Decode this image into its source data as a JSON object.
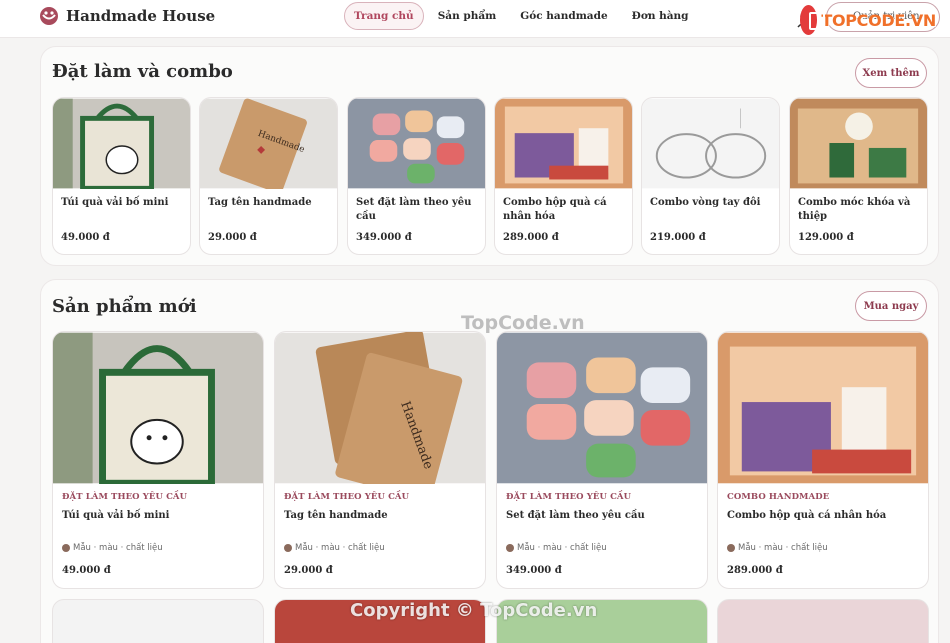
{
  "header": {
    "brand_name": "Handmade House",
    "nav": [
      {
        "label": "Trang chủ",
        "active": true
      },
      {
        "label": "Sản phẩm",
        "active": false
      },
      {
        "label": "Góc handmade",
        "active": false
      },
      {
        "label": "Đơn hàng",
        "active": false
      }
    ],
    "admin_label": "Quản trị viên",
    "watermark_logo": "TOPCODE.VN"
  },
  "combo_section": {
    "title": "Đặt làm và combo",
    "button_label": "Xem thêm",
    "items": [
      {
        "name": "Túi quà vải bố mini",
        "price": "49.000 đ"
      },
      {
        "name": "Tag tên handmade",
        "price": "29.000 đ"
      },
      {
        "name": "Set đặt làm theo yêu cầu",
        "price": "349.000 đ"
      },
      {
        "name": "Combo hộp quà cá nhân hóa",
        "price": "289.000 đ"
      },
      {
        "name": "Combo vòng tay đôi",
        "price": "219.000 đ"
      },
      {
        "name": "Combo móc khóa và thiệp",
        "price": "129.000 đ"
      }
    ]
  },
  "new_section": {
    "title": "Sản phẩm mới",
    "button_label": "Mua ngay",
    "items": [
      {
        "category": "ĐẶT LÀM THEO YÊU CẦU",
        "name": "Túi quà vải bố mini",
        "meta": "Mẫu · màu · chất liệu",
        "price": "49.000 đ"
      },
      {
        "category": "ĐẶT LÀM THEO YÊU CẦU",
        "name": "Tag tên handmade",
        "meta": "Mẫu · màu · chất liệu",
        "price": "29.000 đ"
      },
      {
        "category": "ĐẶT LÀM THEO YÊU CẦU",
        "name": "Set đặt làm theo yêu cầu",
        "meta": "Mẫu · màu · chất liệu",
        "price": "349.000 đ"
      },
      {
        "category": "COMBO HANDMADE",
        "name": "Combo hộp quà cá nhân hóa",
        "meta": "Mẫu · màu · chất liệu",
        "price": "289.000 đ"
      }
    ]
  },
  "watermarks": {
    "center": "TopCode.vn",
    "bottom": "Copyright © TopCode.vn"
  },
  "colors": {
    "accent": "#b0475e",
    "bg": "#f5f4f3"
  }
}
